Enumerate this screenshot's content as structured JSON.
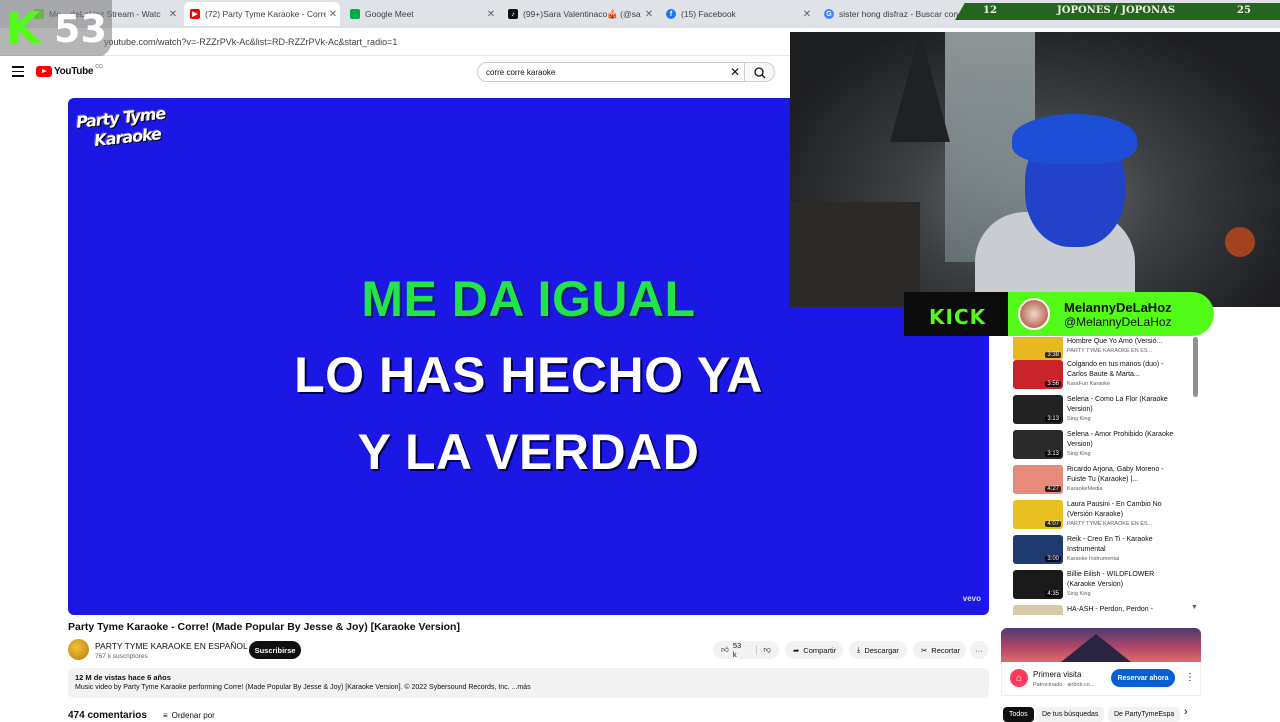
{
  "browser": {
    "tabs": [
      {
        "title": "Me... deLaHoz Stream - Watc",
        "favicon": "kick-icon",
        "color": "#53fc18"
      },
      {
        "title": "(72) Party Tyme Karaoke - Corre",
        "favicon": "youtube-icon",
        "color": "#ff0000"
      },
      {
        "title": "Google Meet",
        "favicon": "meet-icon",
        "color": "#00ac47"
      },
      {
        "title": "(99+)Sara Valentinaco🎪 (@sa",
        "favicon": "tiktok-icon",
        "color": "#111111"
      },
      {
        "title": "(15) Facebook",
        "favicon": "facebook-icon",
        "color": "#1877f2"
      },
      {
        "title": "sister hong disfraz - Buscar con",
        "favicon": "google-icon",
        "color": "#4285f4"
      }
    ],
    "url": "youtube.com/watch?v=-RZZrPVk-Ac&list=RD-RZZrPVk-Ac&start_radio=1"
  },
  "kick_counter": {
    "letter": "K",
    "number": "53"
  },
  "scoreboard": {
    "left": "12",
    "label": "JOPONES / JOPONAS",
    "right": "25"
  },
  "youtube": {
    "logo_word": "YouTube",
    "logo_country": "CO",
    "search_query": "corre corre karaoke",
    "clear_symbol": "✕"
  },
  "video": {
    "brand_line1": "Party Tyme",
    "brand_line2": "Karaoke",
    "lyric_line1": "ME DA IGUAL",
    "lyric_line2": "LO HAS HECHO YA",
    "lyric_line3": "Y LA VERDAD",
    "watermark": "vevo",
    "title": "Party Tyme Karaoke - Corre! (Made Popular By Jesse & Joy) [Karaoke Version]",
    "channel_name": "PARTY TYME KARAOKE EN ESPAÑOL",
    "verified_mark": "⊘",
    "subscribers": "767 k suscriptores",
    "subscribe_label": "Suscribirse",
    "like_count": "53 k",
    "share_label": "Compartir",
    "download_label": "Descargar",
    "clip_label": "Recortar",
    "more_label": "···",
    "views": "12 M de vistas  hace 6 años",
    "description": "Music video by Party Tyme Karaoke performing Corre! (Made Popular By Jesse & Joy) [Karaoke Version]. © 2022 Sybersound Records, Inc. ...más",
    "comments_count": "474 comentarios",
    "sort_label": "Ordenar por"
  },
  "stream_card": {
    "platform": "KICK",
    "name": "MelannyDeLaHoz",
    "handle": "@MelannyDeLaHoz"
  },
  "playlist": [
    {
      "title": "Hombre Que Yo Amo (Versió...",
      "channel": "PARTY TYME KARAOKE EN ES...",
      "duration": "3:38",
      "thumb": "#e8b820"
    },
    {
      "title": "Colgando en tus manos (duo) - Carlos Baute & Marta...",
      "channel": "KaraFun Karaoke",
      "duration": "3:56",
      "thumb": "#c8242a"
    },
    {
      "title": "Selena - Como La Flor (Karaoke Version)",
      "channel": "Sing King",
      "duration": "3:13",
      "thumb": "#222222"
    },
    {
      "title": "Selena - Amor Prohibido (Karaoke Version)",
      "channel": "Sing King",
      "duration": "3:13",
      "thumb": "#2a2a2a"
    },
    {
      "title": "Ricardo Arjona, Gaby Moreno - Fuiste Tu (Karaoke) |...",
      "channel": "KaraokeMedia",
      "duration": "4:27",
      "thumb": "#e88a7a"
    },
    {
      "title": "Laura Pausini - En Cambio No (Versión Karaoke)",
      "channel": "PARTY TYME KARAOKE EN ES...",
      "duration": "4:07",
      "thumb": "#e8c020"
    },
    {
      "title": "Reik - Creo En Ti - Karaoke Instrumental",
      "channel": "Karaoke Instrumental",
      "duration": "3:00",
      "thumb": "#1e3a6e"
    },
    {
      "title": "Billie Eilish - WILDFLOWER (Karaoke Version)",
      "channel": "Sing King",
      "duration": "4:35",
      "thumb": "#1a1a1a"
    },
    {
      "title": "HA-ASH - Perdon, Perdon -",
      "channel": "",
      "duration": "",
      "thumb": "#d8c8a8"
    }
  ],
  "ad": {
    "title": "Primera visita",
    "sponsor": "Patrocinado · airbnb.co...",
    "cta": "Reservar ahora",
    "menu": "⋮"
  },
  "chips": [
    "Todos",
    "De tus búsquedas",
    "De PartyTymeEspa"
  ],
  "chips_next": "›"
}
